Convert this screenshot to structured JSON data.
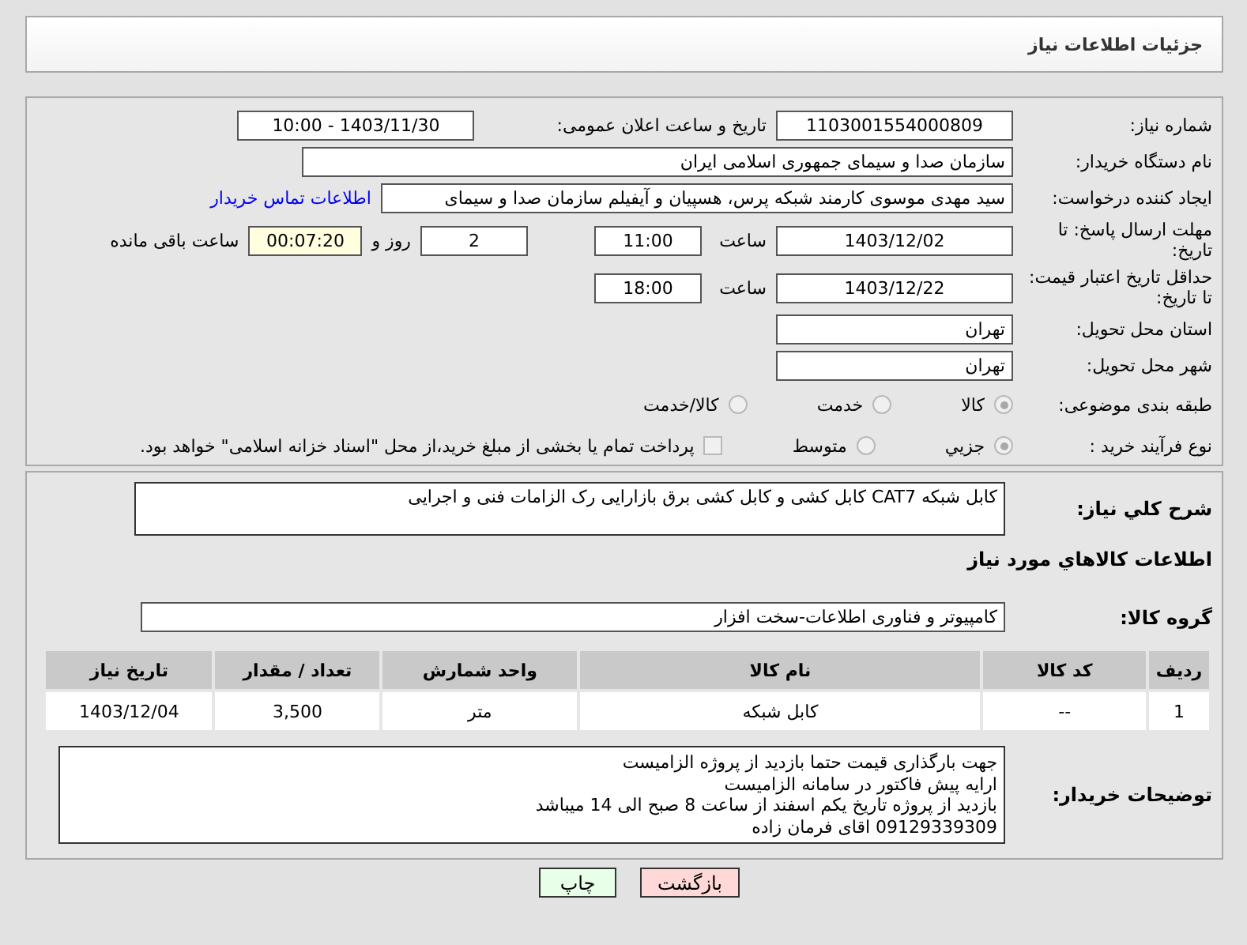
{
  "header": {
    "title": "جزئیات اطلاعات نیاز"
  },
  "info": {
    "need_number": {
      "label": "شماره نیاز:",
      "value": "1103001554000809"
    },
    "announce": {
      "label": "تاریخ و ساعت اعلان عمومی:",
      "value": "1403/11/30 - 10:00"
    },
    "buyer": {
      "label": "نام دستگاه خریدار:",
      "value": "سازمان صدا و سیمای جمهوری اسلامی ایران"
    },
    "creator": {
      "label": "ایجاد کننده درخواست:",
      "value": "سید مهدی موسوی کارمند شبکه پرس، هسپیان و آیفیلم سازمان صدا و سیمای",
      "link": "اطلاعات تماس خریدار"
    },
    "deadline": {
      "label": "مهلت ارسال پاسخ: تا تاریخ:",
      "date": "1403/12/02",
      "time_label": "ساعت",
      "time": "11:00",
      "days": "2",
      "days_label": "روز و",
      "remaining": "00:07:20",
      "remaining_label": "ساعت باقی مانده"
    },
    "validity": {
      "label": "حداقل تاریخ اعتبار قیمت: تا تاریخ:",
      "date": "1403/12/22",
      "time_label": "ساعت",
      "time": "18:00"
    },
    "province": {
      "label": "استان محل تحویل:",
      "value": "تهران"
    },
    "city": {
      "label": "شهر محل تحویل:",
      "value": "تهران"
    },
    "category": {
      "label": "طبقه بندی موضوعی:",
      "options": [
        {
          "label": "کالا",
          "selected": true
        },
        {
          "label": "خدمت",
          "selected": false
        },
        {
          "label": "کالا/خدمت",
          "selected": false
        }
      ]
    },
    "process": {
      "label": "نوع فرآیند خرید :",
      "options": [
        {
          "label": "جزیي",
          "selected": true
        },
        {
          "label": "متوسط",
          "selected": false
        }
      ],
      "treasury": {
        "label": "پرداخت تمام یا بخشی از مبلغ خرید،از محل \"اسناد خزانه اسلامی\" خواهد بود.",
        "checked": false
      }
    }
  },
  "goods": {
    "description": {
      "label": "شرح کلي نياز:",
      "value": "کابل شبکه CAT7 کابل کشی و کابل کشی برق بازارایی رک الزامات فنی و اجرایی"
    },
    "section_title": "اطلاعات کالاهاي مورد نياز",
    "group": {
      "label": "گروه کالا:",
      "value": "کامپیوتر و فناوری اطلاعات-سخت افزار"
    },
    "table": {
      "columns": [
        "ردیف",
        "کد کالا",
        "نام کالا",
        "واحد شمارش",
        "تعداد / مقدار",
        "تاریخ نیاز"
      ],
      "rows": [
        [
          "1",
          "--",
          "کابل شبکه",
          "متر",
          "3,500",
          "1403/12/04"
        ]
      ]
    },
    "notes": {
      "label": "توضیحات خریدار:",
      "lines": [
        "جهت بارگذاری قیمت حتما بازدید از پروژه الزامیست",
        "ارایه پیش فاکتور در سامانه الزامیست",
        "بازدید از پروژه تاریخ یکم اسفند از ساعت 8 صبح الی 14 میباشد",
        "09129339309 اقای فرمان زاده"
      ]
    }
  },
  "buttons": [
    {
      "label": "بازگشت",
      "kind": "back"
    },
    {
      "label": "چاپ",
      "kind": "print"
    }
  ]
}
